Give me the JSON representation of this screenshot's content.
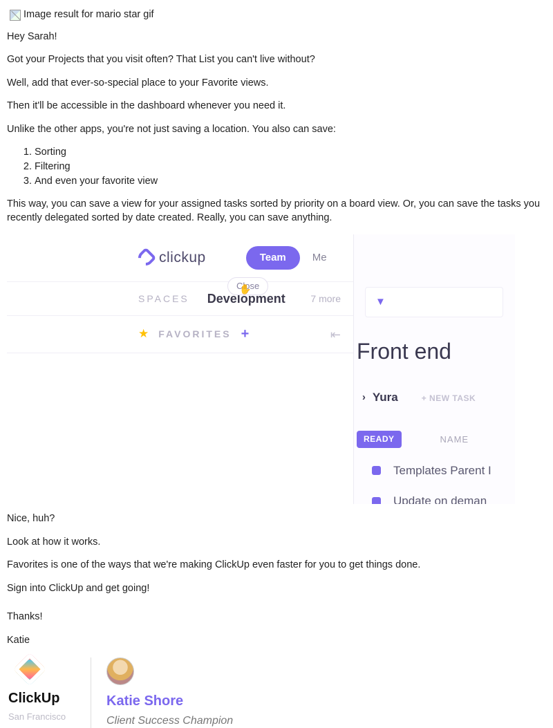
{
  "broken_alt": "Image result for mario star gif",
  "p1": "Hey Sarah!",
  "p2": "Got your Projects that you visit often? That List you can't live without?",
  "p3": "Well, add that ever-so-special place to your Favorite views.",
  "p4": "Then it'll be accessible in the dashboard whenever you need it.",
  "p5": "Unlike the other apps, you're not just saving a location. You also can save:",
  "li1": "Sorting",
  "li2": "Filtering",
  "li3": "And even your favorite view",
  "p6": "This way, you can save a view for your assigned tasks sorted by priority on a board view. Or, you can save the tasks you recently delegated sorted by date created. Really, you can save anything.",
  "shot": {
    "logo": "clickup",
    "team": "Team",
    "me": "Me",
    "close": "Close",
    "spaces": "SPACES",
    "dev": "Development",
    "more": "7 more",
    "fav": "FAVORITES",
    "fe": "Front end",
    "yura": "Yura",
    "newtask": "+ NEW TASK",
    "ready": "READY",
    "name": "NAME",
    "t1": "Templates Parent I",
    "t2": "Update on deman"
  },
  "p7": "Nice, huh?",
  "p8": "Look at how it works.",
  "p9": "Favorites is one of the ways that we're making ClickUp even faster for you to get things done.",
  "p10": "Sign into ClickUp and get going!",
  "p11": "Thanks!",
  "p12": "Katie",
  "sig": {
    "brand": "ClickUp",
    "sf": "San Francisco",
    "name": "Katie Shore",
    "title": "Client Success Champion"
  }
}
